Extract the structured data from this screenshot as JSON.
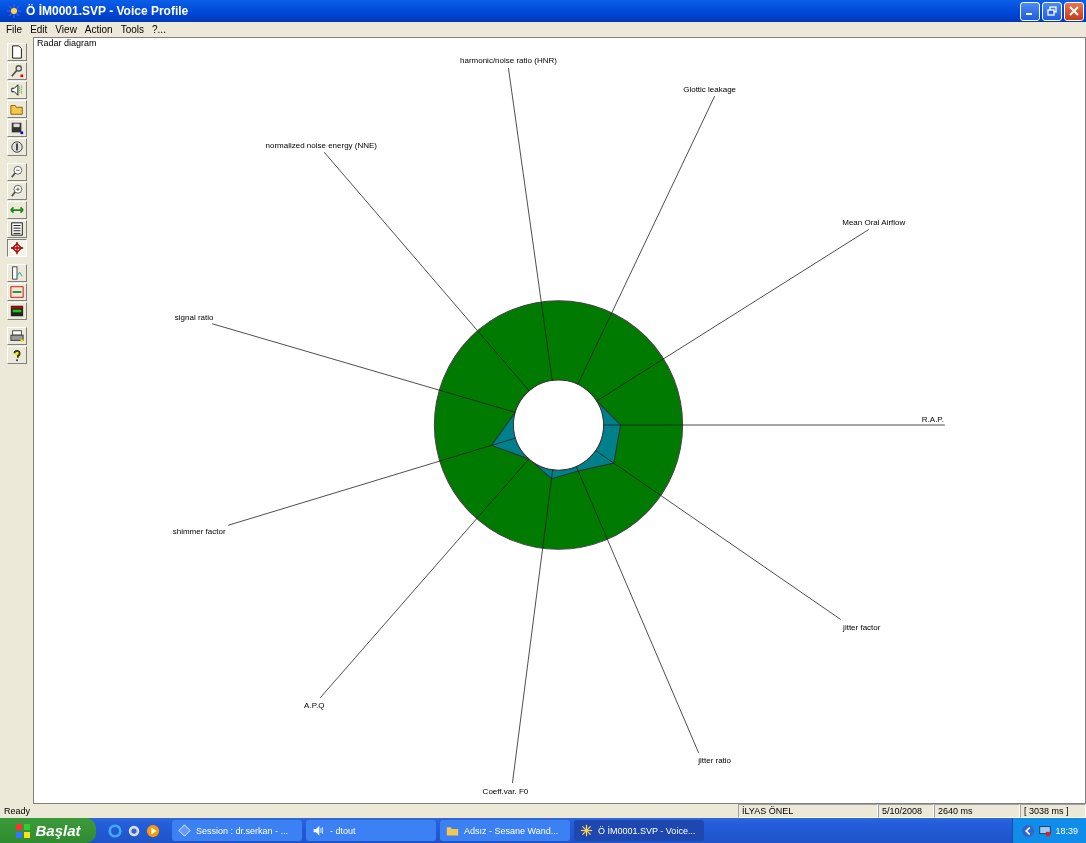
{
  "window": {
    "title": "Ö İM0001.SVP - Voice Profile"
  },
  "menu": [
    "File",
    "Edit",
    "View",
    "Action",
    "Tools",
    "?..."
  ],
  "toolbar": [
    {
      "kind": "new",
      "selected": false
    },
    {
      "kind": "probe",
      "selected": false
    },
    {
      "kind": "speaker",
      "selected": false
    },
    {
      "kind": "open",
      "selected": false
    },
    {
      "kind": "save",
      "selected": false
    },
    {
      "kind": "info",
      "selected": false
    },
    {
      "kind": "zoom-out",
      "selected": false
    },
    {
      "kind": "zoom-in",
      "selected": false
    },
    {
      "kind": "arrows",
      "selected": false
    },
    {
      "kind": "list",
      "selected": false
    },
    {
      "kind": "crosshair",
      "selected": true
    },
    {
      "kind": "ruler",
      "selected": false
    },
    {
      "kind": "fit",
      "selected": false
    },
    {
      "kind": "compress",
      "selected": false
    },
    {
      "kind": "print",
      "selected": false
    },
    {
      "kind": "help",
      "selected": false
    }
  ],
  "panel": {
    "title": "Radar diagram",
    "axes": [
      "harmonic/noise ratio (HNR)",
      "Glottic leakage",
      "Mean Oral Airflow",
      "R.A.P.",
      "jitter factor",
      "jitter ratio",
      "Coeff.var. F0",
      "A.P.Q",
      "shimmer factor",
      "signal ratio",
      "normalized noise energy (NNE)"
    ]
  },
  "status_bar": [
    "Ready",
    "İLYAS ÖNEL",
    "5/10/2008",
    "2640 ms",
    "[ 3038 ms ]"
  ],
  "taskbar": {
    "start": "Başlat",
    "tasks": [
      {
        "kind": "session",
        "label": "Session : dr.serkan - ...",
        "selected": false
      },
      {
        "kind": "sound",
        "label": "- dtout",
        "selected": false
      },
      {
        "kind": "folder",
        "label": "Adsız - Sesane Wand...",
        "selected": false
      },
      {
        "kind": "app",
        "label": "Ö İM0001.SVP - Voice...",
        "selected": true
      }
    ],
    "clock": "18:39"
  }
}
